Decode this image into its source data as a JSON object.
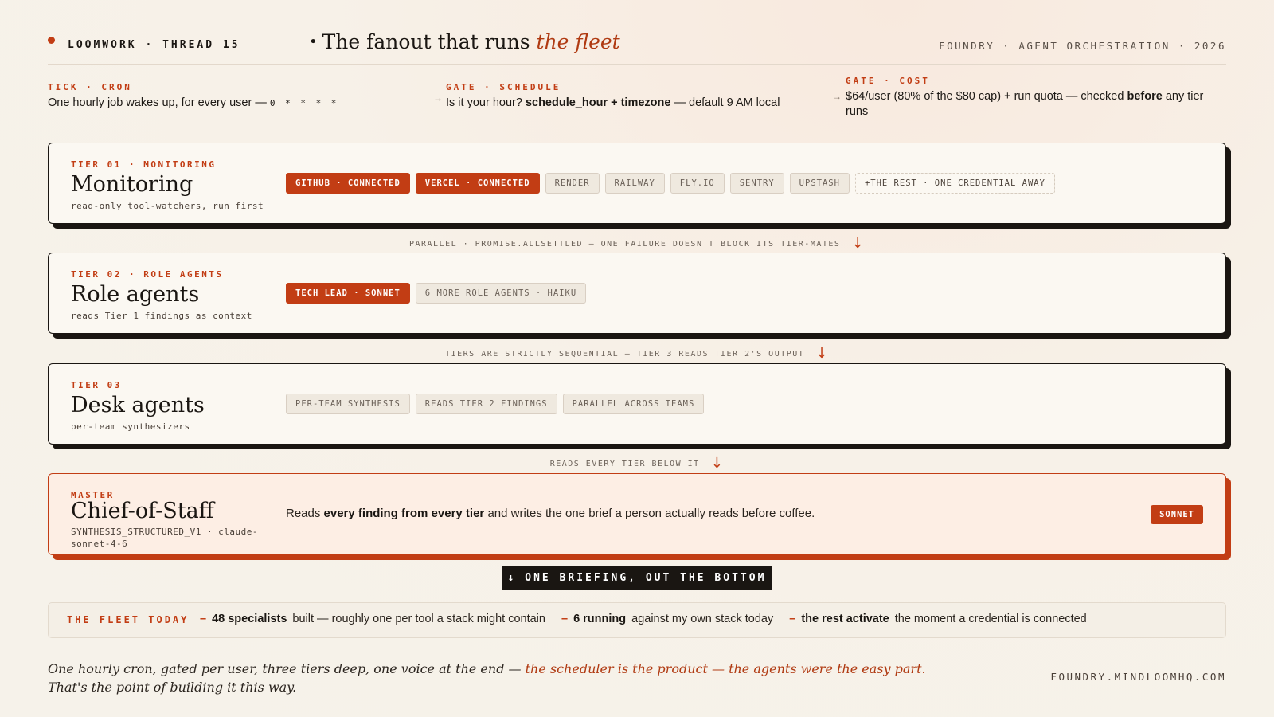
{
  "header": {
    "brand": "LOOMWORK · THREAD 15",
    "title_prefix": "The fanout that runs ",
    "title_emph": "the fleet",
    "tagline": "FOUNDRY · AGENT ORCHESTRATION · 2026"
  },
  "gates": [
    {
      "label": "TICK · CRON",
      "text": "One hourly job wakes up, for every user —",
      "cron": "0 * * * *"
    },
    {
      "label": "GATE · SCHEDULE",
      "text_a": "Is it your hour? ",
      "text_b": "schedule_hour + timezone",
      "text_c": " — default 9 AM local"
    },
    {
      "label": "GATE · COST",
      "text_a": "$64/user (80% of the $80 cap) + run quota — checked ",
      "text_b": "before",
      "text_c": " any tier runs"
    }
  ],
  "tiers": [
    {
      "kicker": "TIER 01 · MONITORING",
      "name": "Monitoring",
      "sub": "read-only tool-watchers, run first",
      "chips": [
        {
          "label": "GITHUB · CONNECTED",
          "state": "on"
        },
        {
          "label": "VERCEL · CONNECTED",
          "state": "on"
        },
        {
          "label": "RENDER",
          "state": "off"
        },
        {
          "label": "RAILWAY",
          "state": "off"
        },
        {
          "label": "FLY.IO",
          "state": "off"
        },
        {
          "label": "SENTRY",
          "state": "off"
        },
        {
          "label": "UPSTASH",
          "state": "off"
        },
        {
          "label": "+THE REST · ONE CREDENTIAL AWAY",
          "state": "dashed"
        }
      ]
    },
    {
      "kicker": "TIER 02 · ROLE AGENTS",
      "name": "Role agents",
      "sub": "reads Tier 1 findings as context",
      "chips": [
        {
          "label": "TECH LEAD · SONNET",
          "state": "on"
        },
        {
          "label": "6 MORE ROLE AGENTS · HAIKU",
          "state": "off"
        }
      ]
    },
    {
      "kicker": "TIER 03",
      "name": "Desk agents",
      "sub": "per-team synthesizers",
      "chips": [
        {
          "label": "PER-TEAM SYNTHESIS",
          "state": "off"
        },
        {
          "label": "READS TIER 2 FINDINGS",
          "state": "off"
        },
        {
          "label": "PARALLEL ACROSS TEAMS",
          "state": "off"
        }
      ]
    }
  ],
  "connectors": [
    "PARALLEL · PROMISE.ALLSETTLED — ONE FAILURE DOESN'T BLOCK ITS TIER-MATES",
    "TIERS ARE STRICTLY SEQUENTIAL — TIER 3 READS TIER 2'S OUTPUT",
    "READS EVERY TIER BELOW IT"
  ],
  "master": {
    "kicker": "MASTER",
    "name": "Chief-of-Staff",
    "sub_line1": "SYNTHESIS_STRUCTURED_V1 · claude-",
    "sub_line2": "sonnet-4-6",
    "desc_a": "Reads ",
    "desc_b": "every finding from every tier",
    "desc_c": " and writes the one brief a person actually reads before coffee.",
    "badge": "SONNET"
  },
  "briefing": "↓ ONE BRIEFING, OUT THE BOTTOM",
  "fleet": {
    "label": "THE FLEET TODAY",
    "items": [
      {
        "bold": "48 specialists",
        "text": "built — roughly one per tool a stack might contain"
      },
      {
        "bold": "6 running",
        "text": "against my own stack today"
      },
      {
        "bold": "the rest activate",
        "text": "the moment a credential is connected"
      }
    ]
  },
  "footer": {
    "quote_a": "One hourly cron, gated per user, three tiers deep, one voice at the end — ",
    "quote_b": "the scheduler is the product — the agents were the easy part.",
    "quote_c": " That's the point of building it this way.",
    "url": "FOUNDRY.MINDLOOMHQ.COM"
  },
  "colors": {
    "accent": "#c23d14",
    "ink": "#1a1612",
    "paper": "#f6f2ea"
  }
}
